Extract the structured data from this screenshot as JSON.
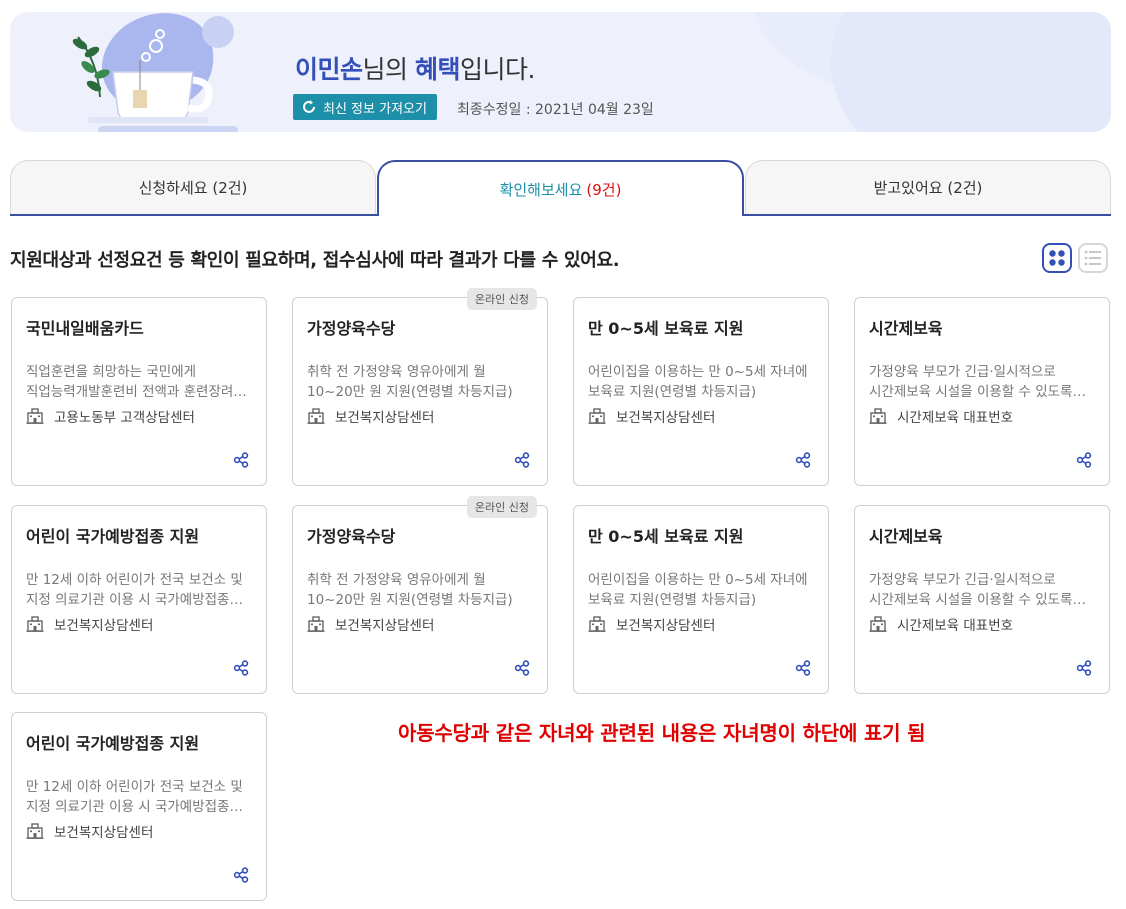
{
  "banner": {
    "user_name": "이민손",
    "greeting_suffix_1": "님의 ",
    "greeting_benefit": "혜택",
    "greeting_suffix_2": "입니다.",
    "refresh_label": "최신 정보 가져오기",
    "last_updated": "최종수정일 : 2021년 04월 23일"
  },
  "tabs": [
    {
      "label": "신청하세요",
      "count": "(2건)"
    },
    {
      "label": "확인해보세요",
      "count": "(9건)"
    },
    {
      "label": "받고있어요",
      "count": "(2건)"
    }
  ],
  "subtitle": "지원대상과 선정요건 등 확인이 필요하며, 접수심사에 따라 결과가 다를 수 있어요.",
  "cards": [
    {
      "title": "국민내일배움카드",
      "desc1": "직업훈련을 희망하는 국민에게",
      "desc2": "직업능력개발훈련비 전액과 훈련장려…",
      "org": "고용노동부 고객상담센터",
      "badge": ""
    },
    {
      "title": "가정양육수당",
      "desc1": "취학 전 가정양육 영유아에게 월",
      "desc2": "10~20만 원 지원(연령별 차등지급)",
      "org": "보건복지상담센터",
      "badge": "온라인 신청"
    },
    {
      "title": "만 0~5세 보육료 지원",
      "desc1": "어린이집을 이용하는 만 0~5세 자녀에",
      "desc2": "보육료 지원(연령별 차등지급)",
      "org": "보건복지상담센터",
      "badge": ""
    },
    {
      "title": "시간제보육",
      "desc1": "가정양육 부모가 긴급·일시적으로",
      "desc2": "시간제보육 시설을 이용할 수 있도록…",
      "org": "시간제보육 대표번호",
      "badge": ""
    },
    {
      "title": "어린이 국가예방접종 지원",
      "desc1": "만 12세 이하 어린이가 전국 보건소 및",
      "desc2": "지정 의료기관 이용 시 국가예방접종…",
      "org": "보건복지상담센터",
      "badge": ""
    },
    {
      "title": "가정양육수당",
      "desc1": "취학 전 가정양육 영유아에게 월",
      "desc2": "10~20만 원 지원(연령별 차등지급)",
      "org": "보건복지상담센터",
      "badge": "온라인 신청"
    },
    {
      "title": "만 0~5세 보육료 지원",
      "desc1": "어린이집을 이용하는 만 0~5세 자녀에",
      "desc2": "보육료 지원(연령별 차등지급)",
      "org": "보건복지상담센터",
      "badge": ""
    },
    {
      "title": "시간제보육",
      "desc1": "가정양육 부모가 긴급·일시적으로",
      "desc2": "시간제보육 시설을 이용할 수 있도록…",
      "org": "시간제보육 대표번호",
      "badge": ""
    },
    {
      "title": "어린이 국가예방접종 지원",
      "desc1": "만 12세 이하 어린이가 전국 보건소 및",
      "desc2": "지정 의료기관 이용 시 국가예방접종…",
      "org": "보건복지상담센터",
      "badge": ""
    }
  ],
  "notice": "아동수당과 같은 자녀와 관련된 내용은 자녀명이 하단에 표기 됨",
  "colors": {
    "accent": "#3350b8",
    "teal": "#1e8fa8",
    "notice_red": "#e00000"
  },
  "icons": {
    "refresh": "refresh-icon",
    "building": "building-icon",
    "share": "share-icon",
    "grid_view": "grid-view-icon",
    "list_view": "list-view-icon"
  }
}
